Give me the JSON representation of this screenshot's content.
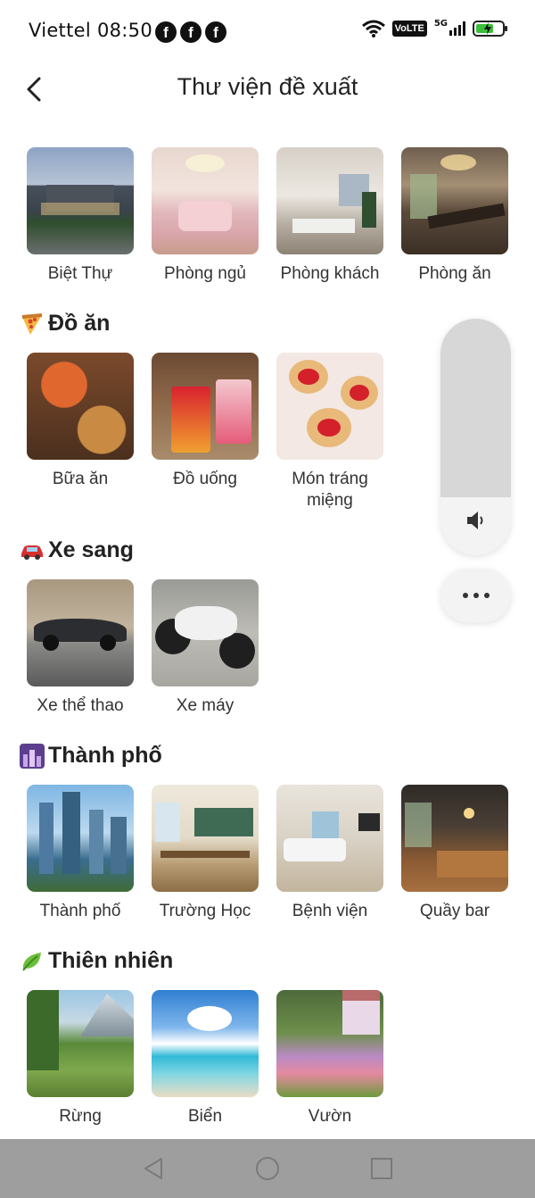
{
  "status_bar": {
    "carrier_time": "Viettel 08:50",
    "fb_glyph": "f",
    "volte": "VoLTE",
    "network": "5G"
  },
  "header": {
    "title": "Thư viện đề xuất"
  },
  "rooms": [
    {
      "label": "Biệt Thự",
      "icon": "villa-image"
    },
    {
      "label": "Phòng ngủ",
      "icon": "bedroom-image"
    },
    {
      "label": "Phòng khách",
      "icon": "living-room-image"
    },
    {
      "label": "Phòng ăn",
      "icon": "dining-room-image"
    }
  ],
  "sections": [
    {
      "title": "Đồ ăn",
      "icon": "pizza-icon",
      "items": [
        {
          "label": "Bữa ăn"
        },
        {
          "label": "Đồ uống"
        },
        {
          "label": "Món tráng miệng"
        }
      ]
    },
    {
      "title": "Xe sang",
      "icon": "car-icon",
      "items": [
        {
          "label": "Xe thể thao"
        },
        {
          "label": "Xe máy"
        }
      ]
    },
    {
      "title": "Thành phố",
      "icon": "city-icon",
      "items": [
        {
          "label": "Thành phố"
        },
        {
          "label": "Trường Học"
        },
        {
          "label": "Bệnh viện"
        },
        {
          "label": "Quầy bar"
        }
      ]
    },
    {
      "title": "Thiên nhiên",
      "icon": "leaf-icon",
      "items": [
        {
          "label": "Rừng"
        },
        {
          "label": "Biển"
        },
        {
          "label": "Vườn"
        }
      ]
    }
  ],
  "volume": {
    "level": 0.0
  },
  "colors": {
    "nav_bar": "#9e9e9e",
    "volume_track": "#d7d7d7",
    "battery": "#3bbf3b"
  }
}
